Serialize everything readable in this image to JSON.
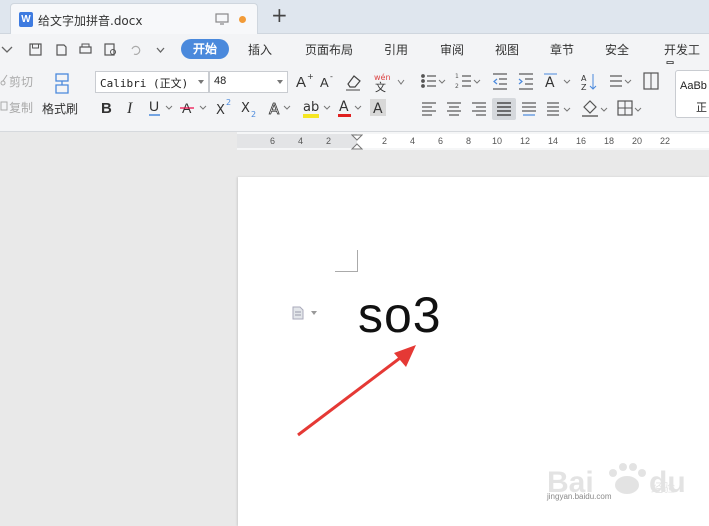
{
  "tab": {
    "title": "给文字加拼音.docx",
    "icon_letter": "W"
  },
  "menu": {
    "items": [
      "开始",
      "插入",
      "页面布局",
      "引用",
      "审阅",
      "视图",
      "章节",
      "安全",
      "开发工具"
    ]
  },
  "ribbon": {
    "cut": "剪切",
    "copy": "复制",
    "format_painter": "格式刷",
    "font_name": "Calibri (正文)",
    "font_size": "48",
    "style_preview": "AaBb",
    "style_name": "正"
  },
  "ruler": {
    "ticks": [
      "6",
      "4",
      "2",
      "2",
      "4",
      "6",
      "8",
      "10",
      "12",
      "14",
      "16",
      "18",
      "20",
      "22"
    ]
  },
  "document": {
    "text": "so3"
  },
  "watermark": {
    "brand": "Baidu经验",
    "url": "jingyan.baidu.com"
  },
  "colors": {
    "accent": "#4a89dc",
    "arrow": "#e53935"
  }
}
